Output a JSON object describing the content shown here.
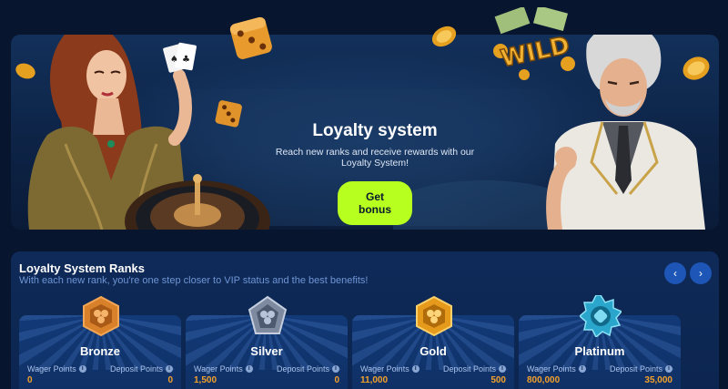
{
  "hero": {
    "title": "Loyalty system",
    "subtitle": "Reach new ranks and receive rewards with our Loyalty System!",
    "button_label": "Get bonus",
    "wild_text": "WILD"
  },
  "ranks": {
    "title": "Loyalty System Ranks",
    "subtitle": "With each new rank, you're one step closer to VIP status and the best benefits!",
    "prev_icon": "‹",
    "next_icon": "›",
    "wager_label": "Wager Points",
    "deposit_label": "Deposit Points",
    "info_glyph": "i",
    "cards": [
      {
        "name": "Bronze",
        "wager": "0",
        "deposit": "0",
        "color": "#d9802a"
      },
      {
        "name": "Silver",
        "wager": "1,500",
        "deposit": "0",
        "color": "#8d9ab0"
      },
      {
        "name": "Gold",
        "wager": "11,000",
        "deposit": "500",
        "color": "#e59a1c"
      },
      {
        "name": "Platinum",
        "wager": "800,000",
        "deposit": "35,000",
        "color": "#3bb8d8"
      }
    ]
  },
  "colors": {
    "accent_button": "#b6ff1e",
    "value_orange": "#f5a12a",
    "background": "#07152f"
  }
}
